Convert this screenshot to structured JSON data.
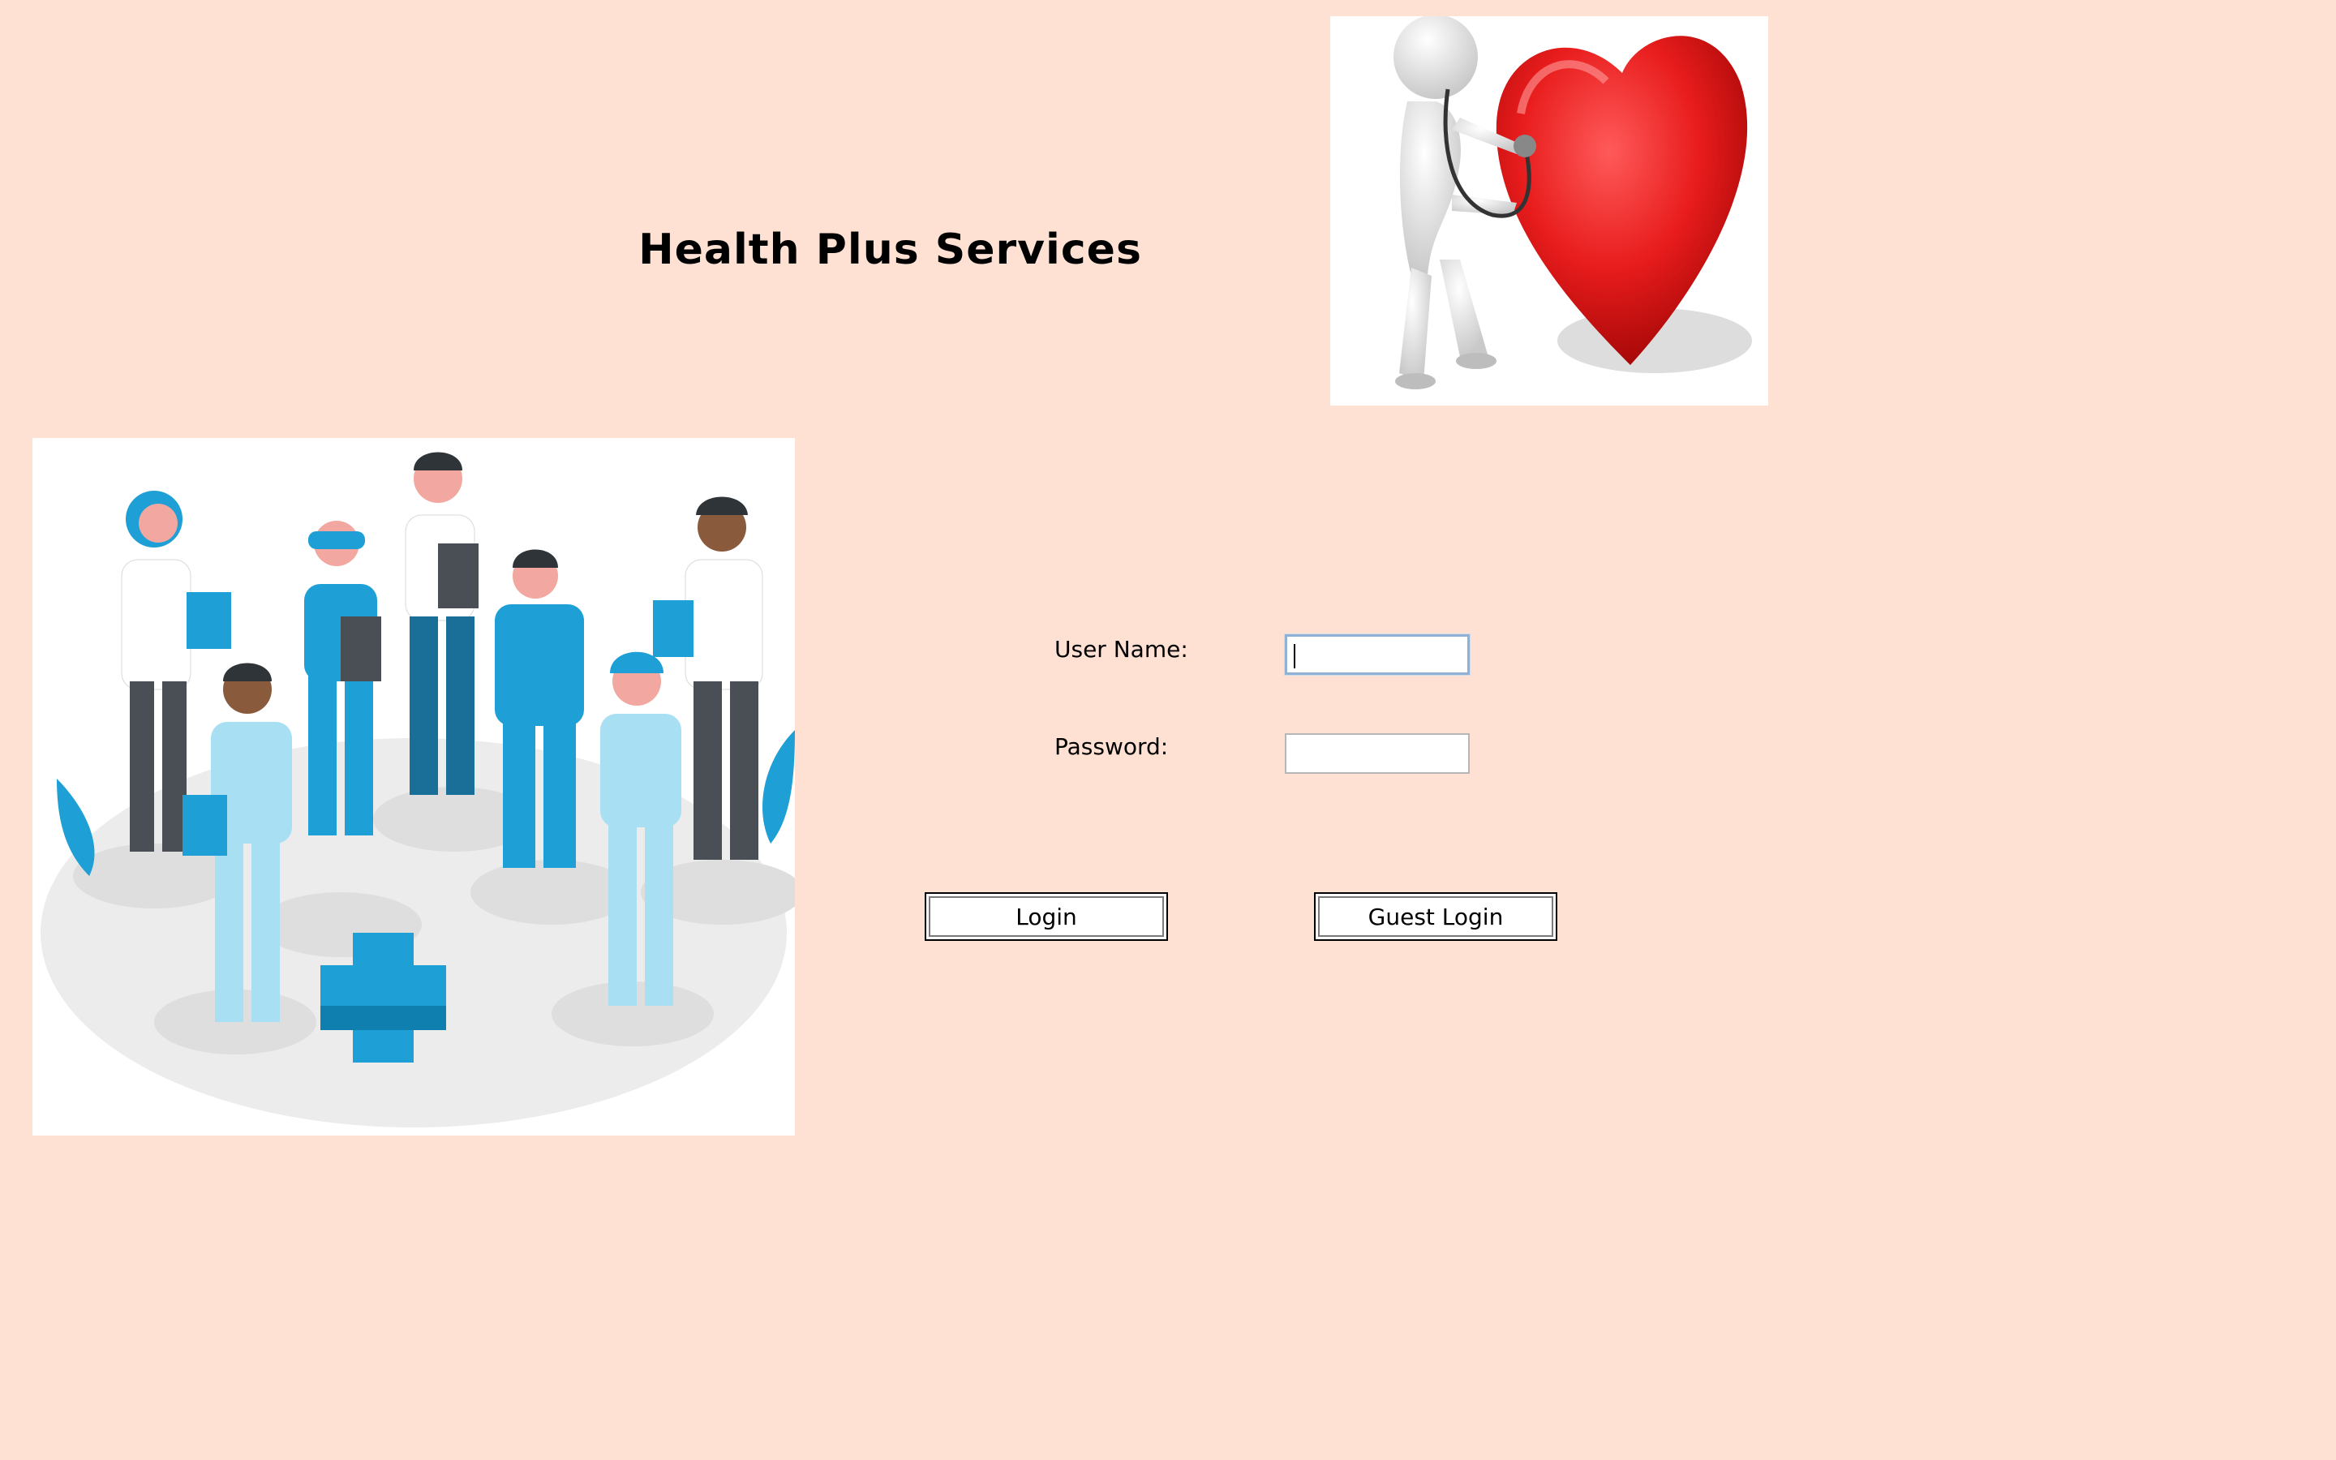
{
  "header": {
    "title": "Health Plus Services"
  },
  "images": {
    "heart": {
      "icon": "doctor-heart-stethoscope-illustration"
    },
    "team": {
      "icon": "medical-team-illustration"
    }
  },
  "form": {
    "username_label": "User Name:",
    "username_value": "",
    "password_label": "Password:",
    "password_value": ""
  },
  "buttons": {
    "login": "Login",
    "guest_login": "Guest Login"
  },
  "colors": {
    "background": "#FFE1D4",
    "accent": "#1E9FD6",
    "heart": "#E8191E"
  }
}
